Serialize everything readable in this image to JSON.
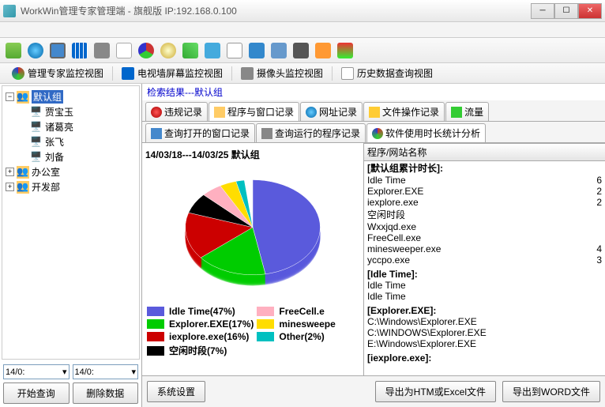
{
  "window": {
    "title": "WorkWin管理专家管理端 - 旗舰版 IP:192.168.0.100"
  },
  "nav_tabs": [
    {
      "label": "管理专家监控视图"
    },
    {
      "label": "电视墙屏幕监控视图"
    },
    {
      "label": "摄像头监控视图"
    },
    {
      "label": "历史数据查询视图"
    }
  ],
  "tree": {
    "root": "默认组",
    "children": [
      "贾宝玉",
      "诸葛亮",
      "张飞",
      "刘备"
    ],
    "siblings": [
      "办公室",
      "开发部"
    ]
  },
  "dates": {
    "from": "14/0:",
    "to": "14/0:"
  },
  "left_buttons": {
    "start": "开始查询",
    "delete": "删除数据"
  },
  "search_result": "检索结果---默认组",
  "main_tabs": [
    {
      "label": "违规记录"
    },
    {
      "label": "程序与窗口记录"
    },
    {
      "label": "网址记录"
    },
    {
      "label": "文件操作记录"
    },
    {
      "label": "流量"
    }
  ],
  "sub_tabs": [
    {
      "label": "查询打开的窗口记录"
    },
    {
      "label": "查询运行的程序记录"
    },
    {
      "label": "软件使用时长统计分析"
    }
  ],
  "chart_data": {
    "type": "pie",
    "title": "14/03/18---14/03/25   默认组",
    "series": [
      {
        "name": "Idle Time",
        "value": 47,
        "color": "#5a5adc"
      },
      {
        "name": "Explorer.EXE",
        "value": 17,
        "color": "#00cc00"
      },
      {
        "name": "iexplore.exe",
        "value": 16,
        "color": "#cc0000"
      },
      {
        "name": "空闲时段",
        "value": 7,
        "color": "#000000"
      },
      {
        "name": "FreeCell.e",
        "value": 5,
        "color": "#ffb0c0"
      },
      {
        "name": "minesweepe",
        "value": 4,
        "color": "#ffdd00"
      },
      {
        "name": "Other",
        "value": 2,
        "color": "#00c0c0"
      }
    ],
    "legend_labels": [
      "Idle Time(47%)",
      "Explorer.EXE(17%)",
      "iexplore.exe(16%)",
      "空闲时段(7%)",
      "FreeCell.e",
      "minesweepe",
      "Other(2%)"
    ]
  },
  "list": {
    "header": "程序/网站名称",
    "groups": [
      {
        "title": "[默认组累计时长]:",
        "items": [
          {
            "name": "Idle Time",
            "val": "6"
          },
          {
            "name": "Explorer.EXE",
            "val": "2"
          },
          {
            "name": "iexplore.exe",
            "val": "2"
          },
          {
            "name": "空闲时段",
            "val": ""
          },
          {
            "name": "Wxxjqd.exe",
            "val": ""
          },
          {
            "name": "FreeCell.exe",
            "val": ""
          },
          {
            "name": "minesweeper.exe",
            "val": "4"
          },
          {
            "name": "yccpo.exe",
            "val": "3"
          }
        ]
      },
      {
        "title": "[Idle Time]:",
        "items": [
          {
            "name": "Idle Time",
            "val": ""
          },
          {
            "name": "Idle Time",
            "val": ""
          }
        ]
      },
      {
        "title": "[Explorer.EXE]:",
        "items": [
          {
            "name": "C:\\Windows\\Explorer.EXE",
            "val": ""
          },
          {
            "name": "C:\\WINDOWS\\Explorer.EXE",
            "val": ""
          },
          {
            "name": "E:\\Windows\\Explorer.EXE",
            "val": ""
          }
        ]
      },
      {
        "title": "[iexplore.exe]:",
        "items": []
      }
    ]
  },
  "footer": {
    "syscfg": "系统设置",
    "export_html": "导出为HTM或Excel文件",
    "export_word": "导出到WORD文件"
  }
}
